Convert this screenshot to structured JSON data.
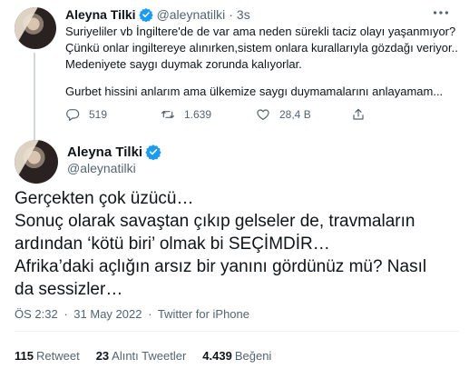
{
  "tweet1": {
    "name": "Aleyna Tilki",
    "handle": "@aleynatilki",
    "separator": "·",
    "time": "3s",
    "lines": [
      "Suriyeliler vb İngiltere'de de var ama neden sürekli taciz olayı yaşanmıyor?",
      "Çünkü onlar ingiltereye alınırken,sistem onlara kurallarıyla gözdağı veriyor..",
      "Medeniyete saygı duymak zorunda kalıyorlar."
    ],
    "last_line": "Gurbet hissini anlarım ama ülkemize saygı duymamalarını anlayamam...",
    "actions": {
      "reply_count": "519",
      "retweet_count": "1.639",
      "like_count": "28,4 B"
    }
  },
  "tweet2": {
    "name": "Aleyna Tilki",
    "handle": "@aleynatilki",
    "lines": [
      "Gerçekten çok üzücü…",
      "Sonuç olarak savaştan çıkıp gelseler de, travmaların",
      "ardından ‘kötü biri’ olmak bi SEÇİMDİR…",
      "Afrika’daki açlığın arsız bir yanını gördünüz mü? Nasıl",
      "da sessizler…"
    ],
    "time": "ÖS 2:32",
    "sep": "·",
    "date": "31 May 2022",
    "source": "Twitter for iPhone",
    "stats": {
      "retweets_count": "115",
      "retweets_label": "Retweet",
      "quotes_count": "23",
      "quotes_label": "Alıntı Tweetler",
      "likes_count": "4.439",
      "likes_label": "Beğeni"
    }
  },
  "colors": {
    "text": "#0f1419",
    "secondary": "#536471",
    "verified": "#1d9bf0",
    "divider": "#eff3f4"
  }
}
